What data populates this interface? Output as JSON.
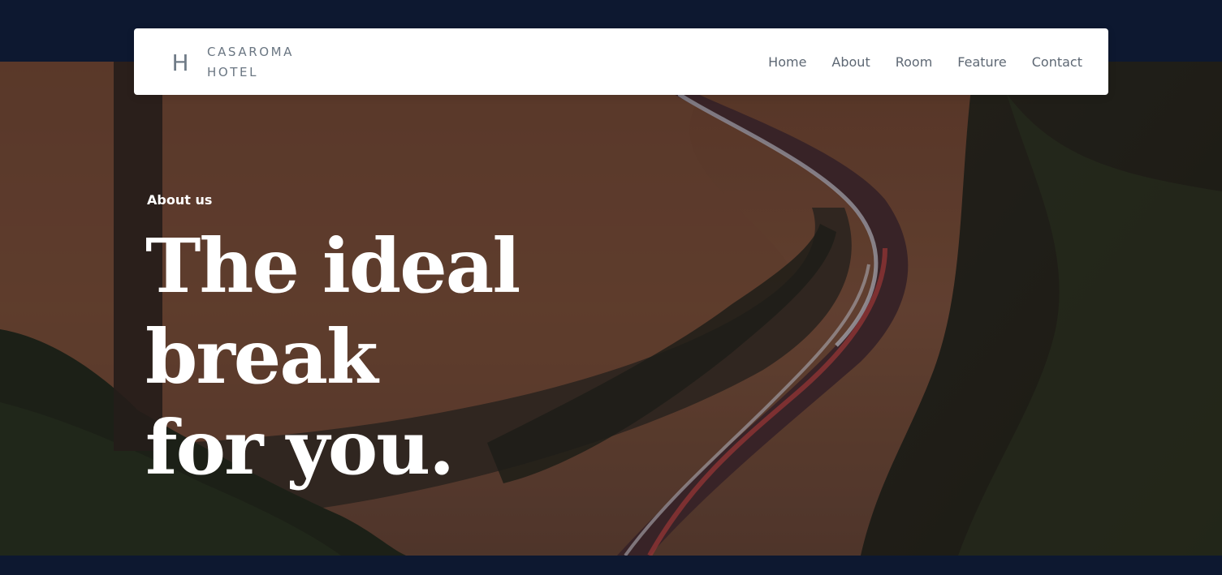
{
  "brand": {
    "mark": "H",
    "line1": "CASAROMA",
    "line2": "HOTEL"
  },
  "nav": {
    "items": [
      {
        "label": "Home"
      },
      {
        "label": "About"
      },
      {
        "label": "Room"
      },
      {
        "label": "Feature"
      },
      {
        "label": "Contact"
      }
    ]
  },
  "hero": {
    "eyebrow": "About us",
    "headline_line1": "The ideal break",
    "headline_line2": "for you."
  },
  "colors": {
    "page_background": "#0d1830",
    "navbar_background": "#ffffff",
    "nav_text": "#5e6874",
    "hero_text": "#ffffff"
  }
}
